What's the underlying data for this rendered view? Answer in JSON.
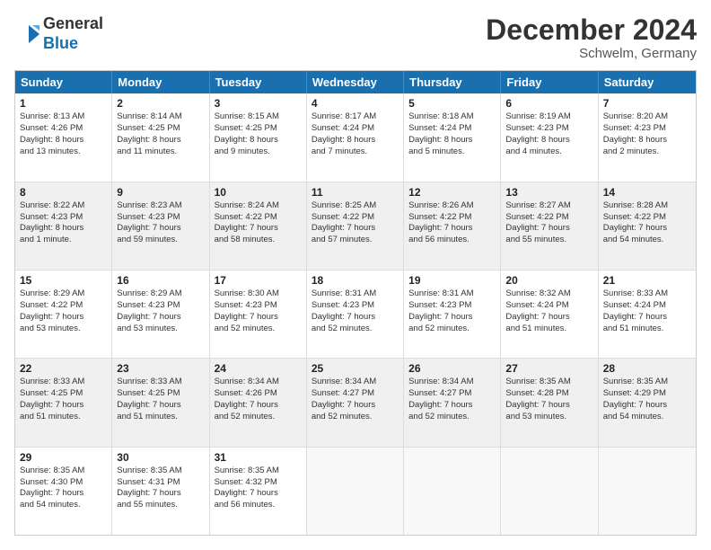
{
  "logo": {
    "line1": "General",
    "line2": "Blue"
  },
  "title": "December 2024",
  "location": "Schwelm, Germany",
  "days_of_week": [
    "Sunday",
    "Monday",
    "Tuesday",
    "Wednesday",
    "Thursday",
    "Friday",
    "Saturday"
  ],
  "weeks": [
    {
      "shaded": false,
      "cells": [
        {
          "day": "1",
          "lines": [
            "Sunrise: 8:13 AM",
            "Sunset: 4:26 PM",
            "Daylight: 8 hours",
            "and 13 minutes."
          ]
        },
        {
          "day": "2",
          "lines": [
            "Sunrise: 8:14 AM",
            "Sunset: 4:25 PM",
            "Daylight: 8 hours",
            "and 11 minutes."
          ]
        },
        {
          "day": "3",
          "lines": [
            "Sunrise: 8:15 AM",
            "Sunset: 4:25 PM",
            "Daylight: 8 hours",
            "and 9 minutes."
          ]
        },
        {
          "day": "4",
          "lines": [
            "Sunrise: 8:17 AM",
            "Sunset: 4:24 PM",
            "Daylight: 8 hours",
            "and 7 minutes."
          ]
        },
        {
          "day": "5",
          "lines": [
            "Sunrise: 8:18 AM",
            "Sunset: 4:24 PM",
            "Daylight: 8 hours",
            "and 5 minutes."
          ]
        },
        {
          "day": "6",
          "lines": [
            "Sunrise: 8:19 AM",
            "Sunset: 4:23 PM",
            "Daylight: 8 hours",
            "and 4 minutes."
          ]
        },
        {
          "day": "7",
          "lines": [
            "Sunrise: 8:20 AM",
            "Sunset: 4:23 PM",
            "Daylight: 8 hours",
            "and 2 minutes."
          ]
        }
      ]
    },
    {
      "shaded": true,
      "cells": [
        {
          "day": "8",
          "lines": [
            "Sunrise: 8:22 AM",
            "Sunset: 4:23 PM",
            "Daylight: 8 hours",
            "and 1 minute."
          ]
        },
        {
          "day": "9",
          "lines": [
            "Sunrise: 8:23 AM",
            "Sunset: 4:23 PM",
            "Daylight: 7 hours",
            "and 59 minutes."
          ]
        },
        {
          "day": "10",
          "lines": [
            "Sunrise: 8:24 AM",
            "Sunset: 4:22 PM",
            "Daylight: 7 hours",
            "and 58 minutes."
          ]
        },
        {
          "day": "11",
          "lines": [
            "Sunrise: 8:25 AM",
            "Sunset: 4:22 PM",
            "Daylight: 7 hours",
            "and 57 minutes."
          ]
        },
        {
          "day": "12",
          "lines": [
            "Sunrise: 8:26 AM",
            "Sunset: 4:22 PM",
            "Daylight: 7 hours",
            "and 56 minutes."
          ]
        },
        {
          "day": "13",
          "lines": [
            "Sunrise: 8:27 AM",
            "Sunset: 4:22 PM",
            "Daylight: 7 hours",
            "and 55 minutes."
          ]
        },
        {
          "day": "14",
          "lines": [
            "Sunrise: 8:28 AM",
            "Sunset: 4:22 PM",
            "Daylight: 7 hours",
            "and 54 minutes."
          ]
        }
      ]
    },
    {
      "shaded": false,
      "cells": [
        {
          "day": "15",
          "lines": [
            "Sunrise: 8:29 AM",
            "Sunset: 4:22 PM",
            "Daylight: 7 hours",
            "and 53 minutes."
          ]
        },
        {
          "day": "16",
          "lines": [
            "Sunrise: 8:29 AM",
            "Sunset: 4:23 PM",
            "Daylight: 7 hours",
            "and 53 minutes."
          ]
        },
        {
          "day": "17",
          "lines": [
            "Sunrise: 8:30 AM",
            "Sunset: 4:23 PM",
            "Daylight: 7 hours",
            "and 52 minutes."
          ]
        },
        {
          "day": "18",
          "lines": [
            "Sunrise: 8:31 AM",
            "Sunset: 4:23 PM",
            "Daylight: 7 hours",
            "and 52 minutes."
          ]
        },
        {
          "day": "19",
          "lines": [
            "Sunrise: 8:31 AM",
            "Sunset: 4:23 PM",
            "Daylight: 7 hours",
            "and 52 minutes."
          ]
        },
        {
          "day": "20",
          "lines": [
            "Sunrise: 8:32 AM",
            "Sunset: 4:24 PM",
            "Daylight: 7 hours",
            "and 51 minutes."
          ]
        },
        {
          "day": "21",
          "lines": [
            "Sunrise: 8:33 AM",
            "Sunset: 4:24 PM",
            "Daylight: 7 hours",
            "and 51 minutes."
          ]
        }
      ]
    },
    {
      "shaded": true,
      "cells": [
        {
          "day": "22",
          "lines": [
            "Sunrise: 8:33 AM",
            "Sunset: 4:25 PM",
            "Daylight: 7 hours",
            "and 51 minutes."
          ]
        },
        {
          "day": "23",
          "lines": [
            "Sunrise: 8:33 AM",
            "Sunset: 4:25 PM",
            "Daylight: 7 hours",
            "and 51 minutes."
          ]
        },
        {
          "day": "24",
          "lines": [
            "Sunrise: 8:34 AM",
            "Sunset: 4:26 PM",
            "Daylight: 7 hours",
            "and 52 minutes."
          ]
        },
        {
          "day": "25",
          "lines": [
            "Sunrise: 8:34 AM",
            "Sunset: 4:27 PM",
            "Daylight: 7 hours",
            "and 52 minutes."
          ]
        },
        {
          "day": "26",
          "lines": [
            "Sunrise: 8:34 AM",
            "Sunset: 4:27 PM",
            "Daylight: 7 hours",
            "and 52 minutes."
          ]
        },
        {
          "day": "27",
          "lines": [
            "Sunrise: 8:35 AM",
            "Sunset: 4:28 PM",
            "Daylight: 7 hours",
            "and 53 minutes."
          ]
        },
        {
          "day": "28",
          "lines": [
            "Sunrise: 8:35 AM",
            "Sunset: 4:29 PM",
            "Daylight: 7 hours",
            "and 54 minutes."
          ]
        }
      ]
    },
    {
      "shaded": false,
      "cells": [
        {
          "day": "29",
          "lines": [
            "Sunrise: 8:35 AM",
            "Sunset: 4:30 PM",
            "Daylight: 7 hours",
            "and 54 minutes."
          ]
        },
        {
          "day": "30",
          "lines": [
            "Sunrise: 8:35 AM",
            "Sunset: 4:31 PM",
            "Daylight: 7 hours",
            "and 55 minutes."
          ]
        },
        {
          "day": "31",
          "lines": [
            "Sunrise: 8:35 AM",
            "Sunset: 4:32 PM",
            "Daylight: 7 hours",
            "and 56 minutes."
          ]
        },
        {
          "day": "",
          "lines": []
        },
        {
          "day": "",
          "lines": []
        },
        {
          "day": "",
          "lines": []
        },
        {
          "day": "",
          "lines": []
        }
      ]
    }
  ]
}
